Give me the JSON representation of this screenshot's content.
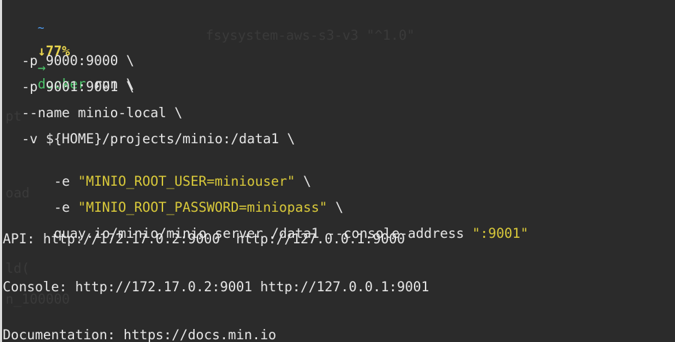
{
  "prompt": {
    "dir": "~",
    "battery": "↓77%",
    "arrow": "→",
    "command": "docker",
    "args": " run \\"
  },
  "lines": [
    "  -p 9000:9000 \\",
    "  -p 9001:9001 \\",
    "  --name minio-local \\",
    "  -v ${HOME}/projects/minio:/data1 \\"
  ],
  "env_lines": [
    {
      "flag": "  -e ",
      "value": "\"MINIO_ROOT_USER=miniouser\"",
      "tail": " \\"
    },
    {
      "flag": "  -e ",
      "value": "\"MINIO_ROOT_PASSWORD=miniopass\"",
      "tail": " \\"
    }
  ],
  "image_line": {
    "text": "  quay.io/minio/minio server /data1 --console-address ",
    "value": "\":9001\""
  },
  "output": {
    "api": "API: http://172.17.0.2:9000  http://127.0.0.1:9000",
    "console": "Console: http://172.17.0.2:9001 http://127.0.0.1:9001",
    "documentation": "Documentation: https://docs.min.io"
  },
  "colors": {
    "background": "#2b2b2b",
    "command_green": "#4cc36a",
    "string_yellow": "#d9c93a",
    "tilde_blue": "#4fa3ff",
    "battery_yellow": "#e8d44d",
    "text": "#e6e6e6"
  }
}
